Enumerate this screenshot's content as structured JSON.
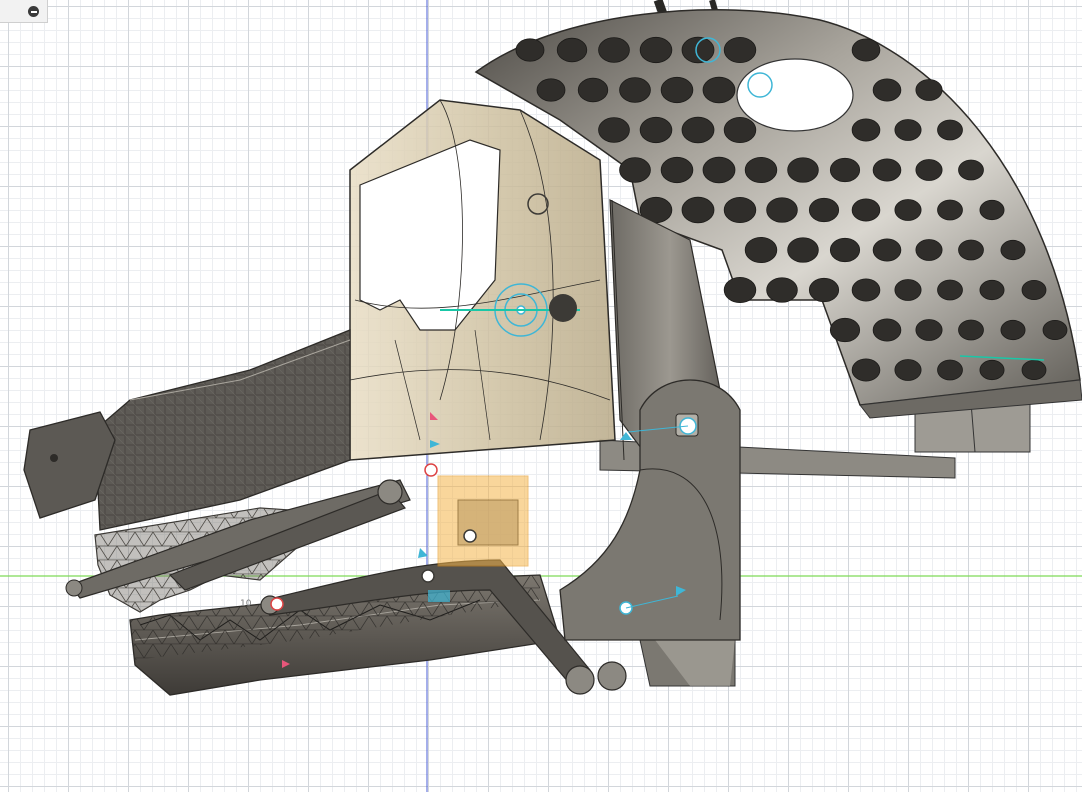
{
  "app": {
    "panel_toggle_label": ""
  },
  "viewport": {
    "dimension_label": "10"
  },
  "colors": {
    "grid_major": "#d2d6db",
    "grid_minor": "#eceef1",
    "axis_x": "#7ed957",
    "axis_y": "#4a5cd6",
    "metal": "#7a766e",
    "metal_dark": "#3c3a36",
    "translucent_shell": "#d6c9a8",
    "mesh": "#55524d",
    "joint_cyan": "#3fb6d6",
    "selection_orange": "#f5b54a"
  }
}
